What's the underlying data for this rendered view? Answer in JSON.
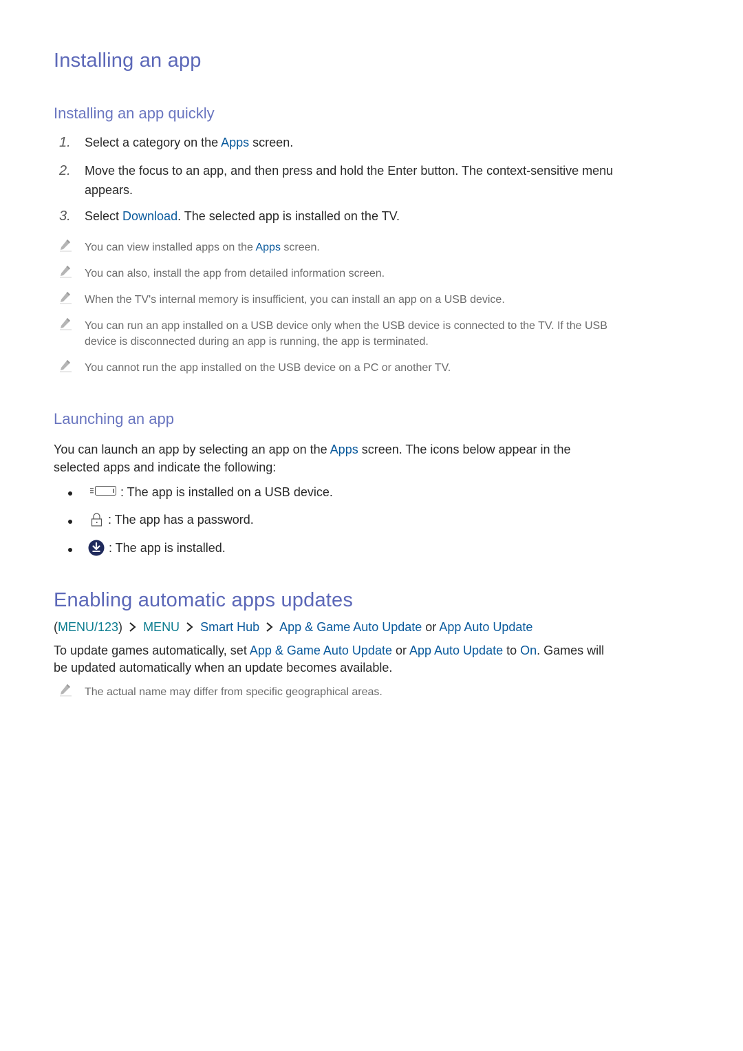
{
  "section1": {
    "title": "Installing an app",
    "sub1": {
      "title": "Installing an app quickly",
      "steps": [
        {
          "num": "1.",
          "pre": "Select a category on the ",
          "link": "Apps",
          "post": " screen."
        },
        {
          "num": "2.",
          "line1": "Move the focus to an app, and then press and hold the Enter button. The context-sensitive menu",
          "line2": "appears."
        },
        {
          "num": "3.",
          "pre": "Select ",
          "link": "Download",
          "post": ". The selected app is installed on the TV."
        }
      ],
      "notes": [
        {
          "pre": "You can view installed apps on the ",
          "link": "Apps",
          "post": " screen."
        },
        {
          "text": "You can also, install the app from detailed information screen."
        },
        {
          "text": "When the TV's internal memory is insufficient, you can install an app on a USB device."
        },
        {
          "line1": "You can run an app installed on a USB device only when the USB device is connected to the TV. If the USB",
          "line2": "device is disconnected during an app is running, the app is terminated."
        },
        {
          "text": "You cannot run the app installed on the USB device on a PC or another TV."
        }
      ],
      "note_icon": "pencil-icon"
    },
    "sub2": {
      "title": "Launching an app",
      "intro_pre": "You can launch an app by selecting an app on the ",
      "intro_link": "Apps",
      "intro_post": " screen. The icons below appear in the",
      "intro_line2": "selected apps and indicate the following:",
      "bullets": [
        {
          "icon": "usb-device-icon",
          "text": ": The app is installed on a USB device."
        },
        {
          "icon": "lock-icon",
          "text": ": The app has a password."
        },
        {
          "icon": "installed-download-icon",
          "text": ": The app is installed."
        }
      ]
    }
  },
  "section2": {
    "title": "Enabling automatic apps updates",
    "path": {
      "open": "(",
      "menu123": "MENU/123",
      "close": ")",
      "menu": "MENU",
      "smart_hub": "Smart Hub",
      "app_game": "App & Game Auto Update",
      "or": " or ",
      "app_auto": "App Auto Update"
    },
    "body": {
      "pre": "To update games automatically, set ",
      "link1": "App & Game Auto Update",
      "or": " or ",
      "link2": "App Auto Update",
      "to": " to ",
      "link3": "On",
      "post": ". Games will",
      "line2": "be updated automatically when an update becomes available."
    },
    "note": "The actual name may differ from specific geographical areas."
  }
}
